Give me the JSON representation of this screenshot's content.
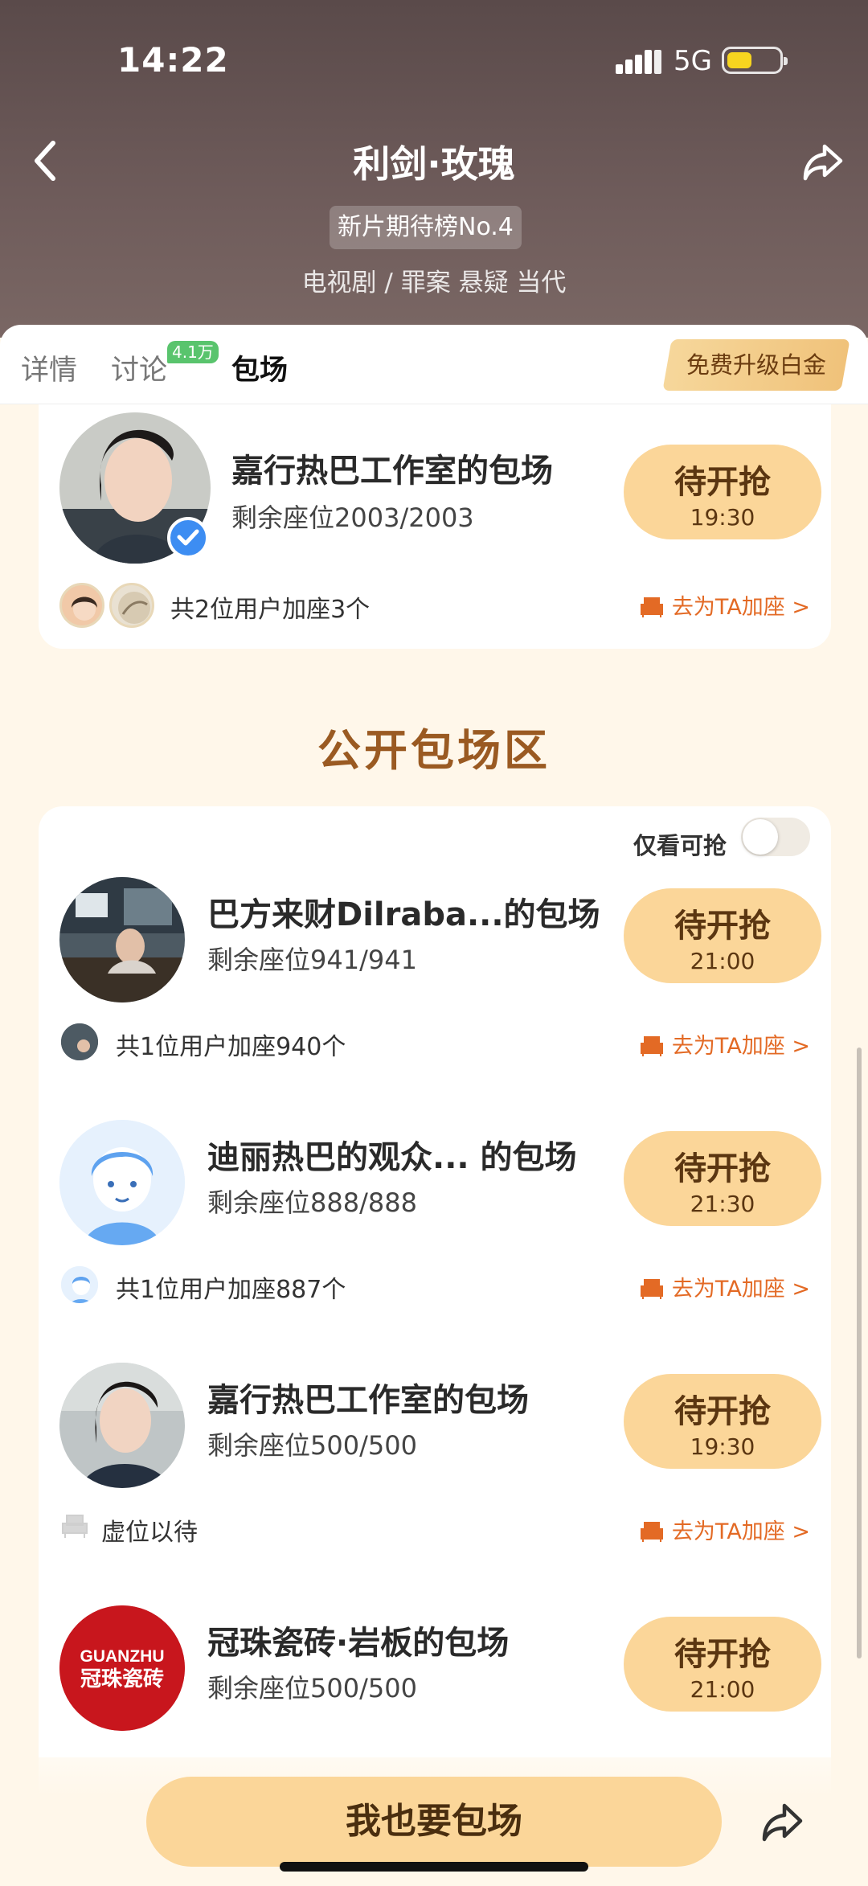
{
  "status": {
    "time": "14:22",
    "network": "5G"
  },
  "header": {
    "title": "利剑·玫瑰",
    "rank_badge": "新片期待榜No.4",
    "genre": "电视剧 / 罪案 悬疑 当代"
  },
  "tabs": [
    {
      "label": "详情"
    },
    {
      "label": "讨论",
      "badge": "4.1万"
    },
    {
      "label": "包场"
    }
  ],
  "upgrade_label": "免费升级白金",
  "featured": {
    "name": "嘉行热巴工作室的包场",
    "seats": "剩余座位2003/2003",
    "status": "待开抢",
    "time": "19:30",
    "joined": "共2位用户加座3个",
    "goto": "去为TA加座 >"
  },
  "public_section": {
    "title": "公开包场区",
    "filter_label": "仅看可抢",
    "filter_on": false,
    "rows": [
      {
        "name": "巴方来财Dilraba...的包场",
        "seats": "剩余座位941/941",
        "status": "待开抢",
        "time": "21:00",
        "joined": "共1位用户加座940个",
        "goto": "去为TA加座 >",
        "avatar": "office-photo"
      },
      {
        "name": "迪丽热巴的观众... 的包场",
        "seats": "剩余座位888/888",
        "status": "待开抢",
        "time": "21:30",
        "joined": "共1位用户加座887个",
        "goto": "去为TA加座 >",
        "avatar": "default-avatar"
      },
      {
        "name": "嘉行热巴工作室的包场",
        "seats": "剩余座位500/500",
        "status": "待开抢",
        "time": "19:30",
        "joined": "虚位以待",
        "goto": "去为TA加座 >",
        "avatar": "woman-portrait"
      },
      {
        "name": "冠珠瓷砖·岩板的包场",
        "seats": "剩余座位500/500",
        "status": "待开抢",
        "time": "21:00",
        "avatar": "guanzhu-logo",
        "logo_text_top": "GUANZHU",
        "logo_text_bottom": "冠珠瓷砖"
      }
    ]
  },
  "cta": "我也要包场",
  "colors": {
    "accent": "#fbd699",
    "link": "#e36a25",
    "section_title": "#9a5a22"
  }
}
